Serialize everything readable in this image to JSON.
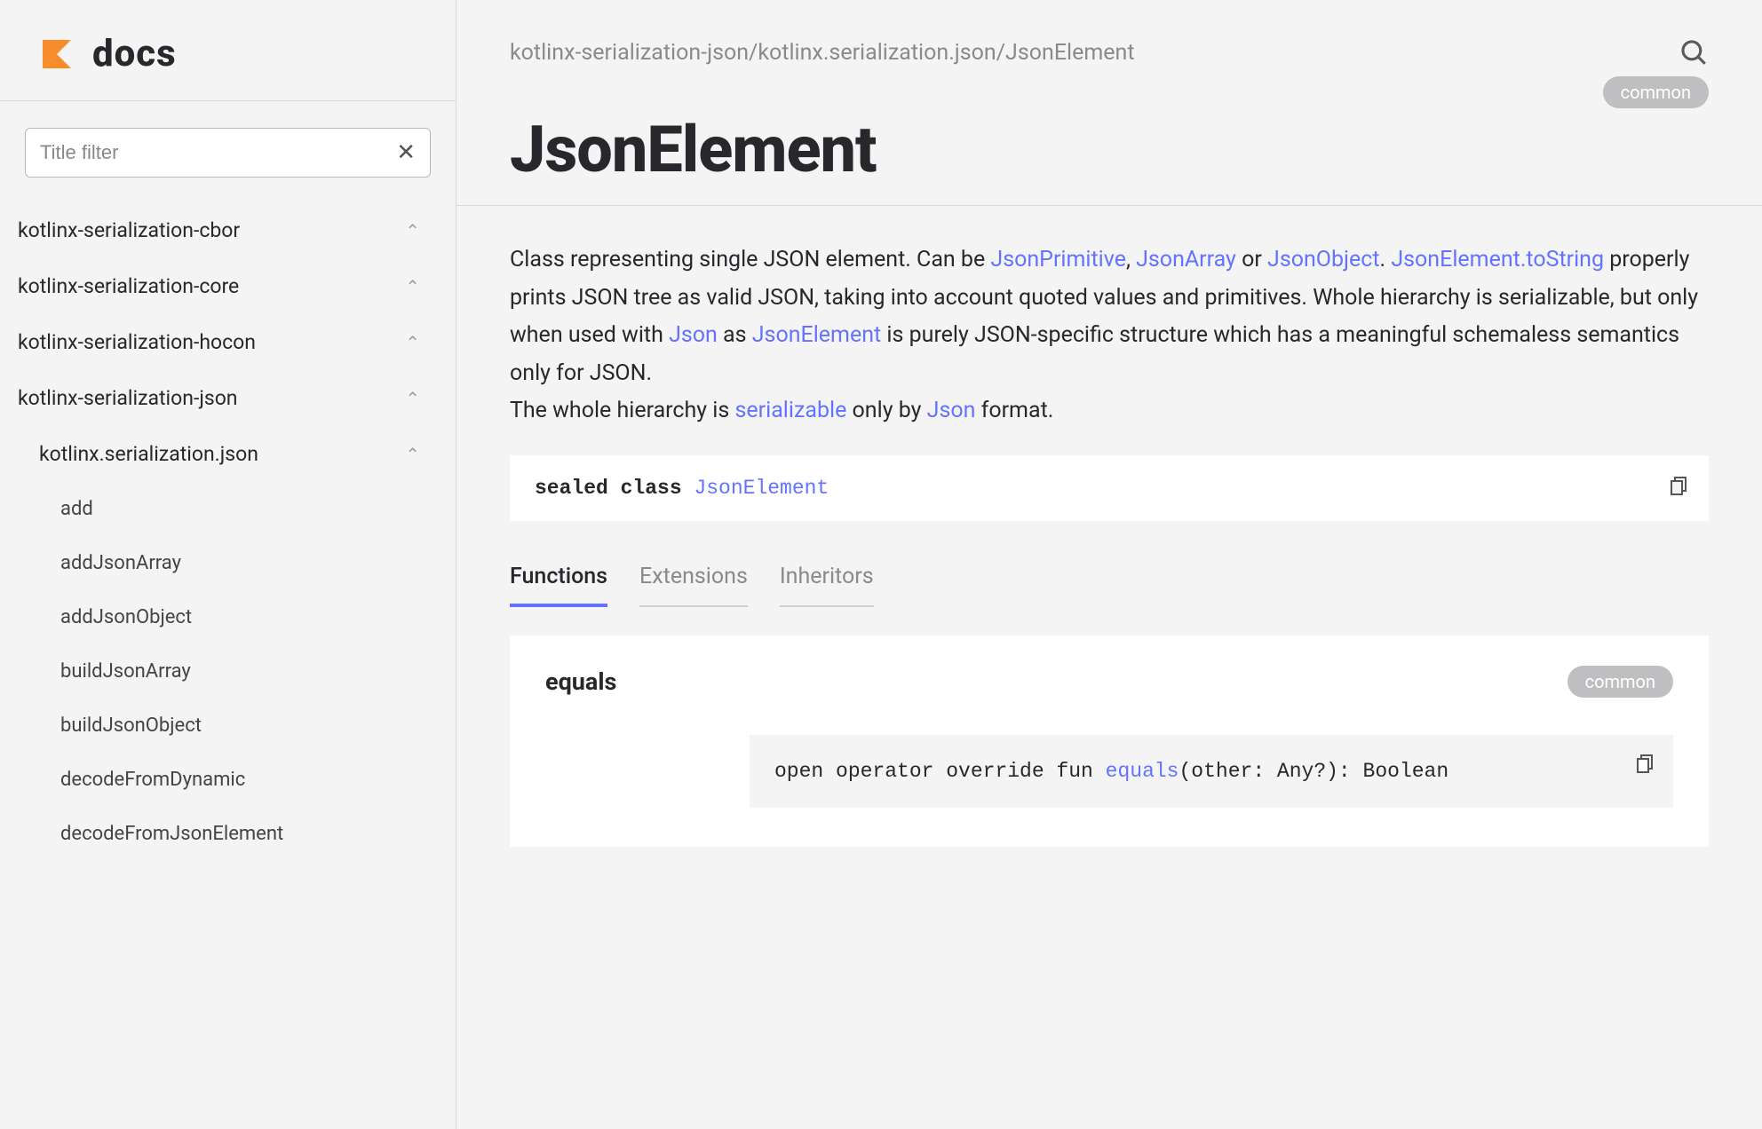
{
  "logo_text": "docs",
  "filter": {
    "placeholder": "Title filter"
  },
  "nav": {
    "groups": [
      {
        "label": "kotlinx-serialization-cbor"
      },
      {
        "label": "kotlinx-serialization-core"
      },
      {
        "label": "kotlinx-serialization-hocon"
      },
      {
        "label": "kotlinx-serialization-json"
      }
    ],
    "subpackage": "kotlinx.serialization.json",
    "items": [
      "add",
      "addJsonArray",
      "addJsonObject",
      "buildJsonArray",
      "buildJsonObject",
      "decodeFromDynamic",
      "decodeFromJsonElement"
    ]
  },
  "breadcrumb": "kotlinx-serialization-json/kotlinx.serialization.json/JsonElement",
  "badge": "common",
  "page_title": "JsonElement",
  "desc": {
    "p1a": "Class representing single JSON element. Can be ",
    "link1": "JsonPrimitive",
    "p1b": ", ",
    "link2": "JsonArray",
    "p1c": " or ",
    "link3": "JsonObject",
    "p1d": ". ",
    "link4": "JsonElement.toString",
    "p1e": " properly prints JSON tree as valid JSON, taking into account quoted values and primitives. Whole hierarchy is serializable, but only when used with ",
    "link5": "Json",
    "p1f": " as ",
    "link6": "JsonElement",
    "p1g": " is purely JSON-specific structure which has a meaningful schemaless semantics only for JSON.",
    "p2a": "The whole hierarchy is ",
    "link7": "serializable",
    "p2b": " only by ",
    "link8": "Json",
    "p2c": " format."
  },
  "signature": {
    "kw": "sealed class ",
    "type": "JsonElement"
  },
  "tabs": [
    "Functions",
    "Extensions",
    "Inheritors"
  ],
  "member": {
    "name": "equals",
    "badge": "common",
    "sig_pre": "open operator override fun ",
    "sig_fn": "equals",
    "sig_post": "(other: Any?): Boolean"
  }
}
